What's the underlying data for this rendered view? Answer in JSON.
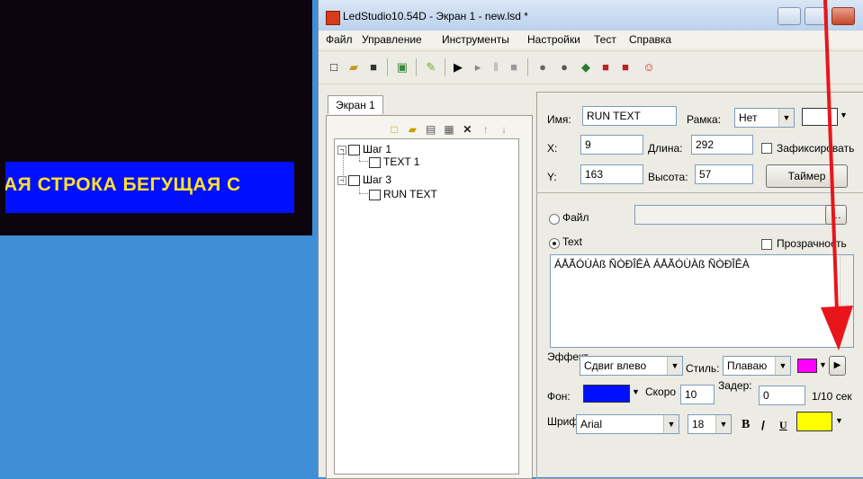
{
  "led_preview": {
    "marquee_text": "АЯ СТРОКА БЕГУЩАЯ С"
  },
  "window": {
    "title": "LedStudio10.54D - Экран 1 - new.lsd *"
  },
  "menu": [
    "Файл",
    "Управление",
    "Инструменты",
    "Настройки",
    "Тест",
    "Справка"
  ],
  "left": {
    "tab": "Экран 1",
    "tree": [
      {
        "label": "Шаг 1",
        "level": 0,
        "expander": "−"
      },
      {
        "label": "TEXT 1",
        "level": 1
      },
      {
        "label": "Шаг 3",
        "level": 0,
        "expander": "−"
      },
      {
        "label": "RUN TEXT",
        "level": 1
      }
    ]
  },
  "props": {
    "name_label": "Имя:",
    "name_value": "RUN TEXT",
    "frame_label": "Рамка:",
    "frame_value": "Нет",
    "x_label": "X:",
    "x_value": "9",
    "length_label": "Длина:",
    "length_value": "292",
    "fixed_label": "Зафиксировать",
    "y_label": "Y:",
    "y_value": "163",
    "height_label": "Высота:",
    "height_value": "57",
    "timer_button": "Таймер",
    "file_radio": "Файл",
    "text_radio": "Text",
    "transparent_label": "Прозрачность",
    "text_content": "ÁÅÃÓÙÀß ÑÒÐÎÊÀ ÁÅÃÓÙÀß ÑÒÐÎÊÀ",
    "effect_label": "Эффект",
    "effect_value": "Сдвиг влево",
    "style_label": "Стиль:",
    "style_value": "Плаваю",
    "bg_label": "Фон:",
    "speed_label": "Скоро",
    "speed_value": "10",
    "delay_label": "Задер:",
    "delay_value": "0",
    "delay_unit": "1/10 сек",
    "font_label": "Шрифт",
    "font_value": "Arial",
    "size_value": "18",
    "bold": "B",
    "italic": "/",
    "underline": "U"
  },
  "colors": {
    "effect_color": "#ff00ff",
    "bg_color": "#0010ff",
    "font_color": "#ffff00",
    "annotation_arrow": "#e8151b"
  }
}
